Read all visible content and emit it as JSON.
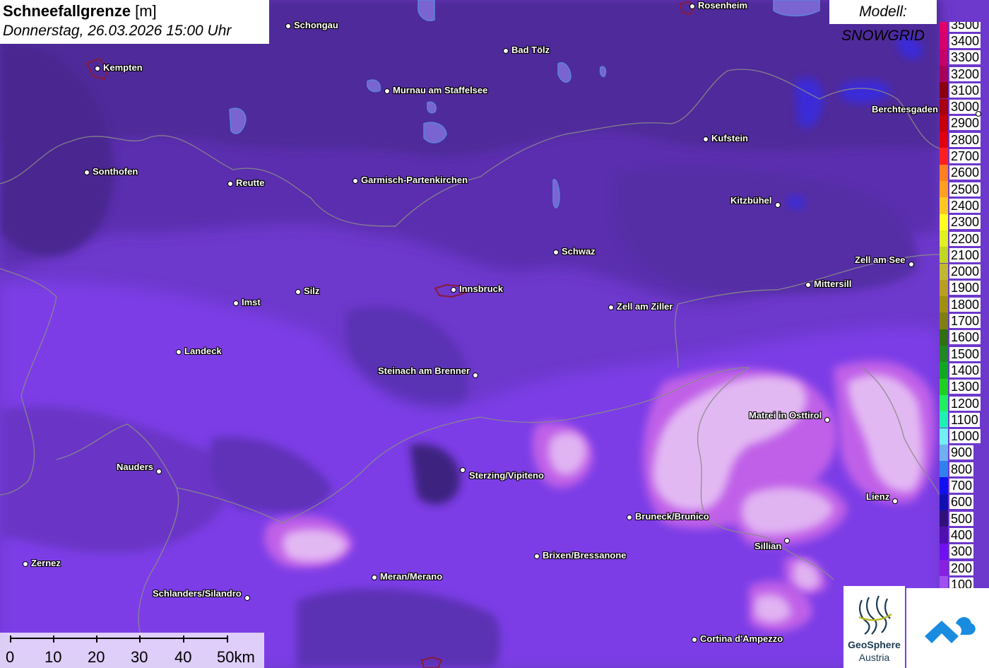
{
  "title": {
    "variable": "Schneefallgrenze",
    "unit": "[m]",
    "datetime": "Donnerstag, 26.03.2026 15:00 Uhr"
  },
  "model": "Modell: SNOWGRID",
  "legend": [
    {
      "label": "3500",
      "color": "#e0006a"
    },
    {
      "label": "3400",
      "color": "#d4006e"
    },
    {
      "label": "3300",
      "color": "#c4006a"
    },
    {
      "label": "3200",
      "color": "#a8005a"
    },
    {
      "label": "3100",
      "color": "#8a0010"
    },
    {
      "label": "3000",
      "color": "#a80010"
    },
    {
      "label": "2900",
      "color": "#c40008"
    },
    {
      "label": "2800",
      "color": "#e00010"
    },
    {
      "label": "2700",
      "color": "#ff2020"
    },
    {
      "label": "2600",
      "color": "#ff8020"
    },
    {
      "label": "2500",
      "color": "#ffa020"
    },
    {
      "label": "2400",
      "color": "#ffc820"
    },
    {
      "label": "2300",
      "color": "#ffff20"
    },
    {
      "label": "2200",
      "color": "#e0f020"
    },
    {
      "label": "2100",
      "color": "#c0d820"
    },
    {
      "label": "2000",
      "color": "#c0b830"
    },
    {
      "label": "1900",
      "color": "#b8a020"
    },
    {
      "label": "1800",
      "color": "#a09010"
    },
    {
      "label": "1700",
      "color": "#808010"
    },
    {
      "label": "1600",
      "color": "#307010"
    },
    {
      "label": "1500",
      "color": "#208820"
    },
    {
      "label": "1400",
      "color": "#10a820"
    },
    {
      "label": "1300",
      "color": "#20d020"
    },
    {
      "label": "1200",
      "color": "#20f060"
    },
    {
      "label": "1100",
      "color": "#20f0b0"
    },
    {
      "label": "1000",
      "color": "#70f0f0"
    },
    {
      "label": "900",
      "color": "#70b0f0"
    },
    {
      "label": "800",
      "color": "#3080f0"
    },
    {
      "label": "700",
      "color": "#1010f0"
    },
    {
      "label": "600",
      "color": "#1010b0"
    },
    {
      "label": "500",
      "color": "#30107a"
    },
    {
      "label": "400",
      "color": "#5010b0"
    },
    {
      "label": "300",
      "color": "#7010f0"
    },
    {
      "label": "200",
      "color": "#8820e0"
    },
    {
      "label": "100",
      "color": "#a050f0"
    }
  ],
  "cities": [
    {
      "name": "Rosenheim"
    },
    {
      "name": "Schongau"
    },
    {
      "name": "Kempten"
    },
    {
      "name": "Bad Tölz"
    },
    {
      "name": "Murnau am Staffelsee"
    },
    {
      "name": "Berchtesgaden"
    },
    {
      "name": "Kufstein"
    },
    {
      "name": "Sonthofen"
    },
    {
      "name": "Reutte"
    },
    {
      "name": "Garmisch-Partenkirchen"
    },
    {
      "name": "Kitzbühel"
    },
    {
      "name": "Schwaz"
    },
    {
      "name": "Zell am See"
    },
    {
      "name": "Mittersill"
    },
    {
      "name": "Imst"
    },
    {
      "name": "Silz"
    },
    {
      "name": "Innsbruck"
    },
    {
      "name": "Zell am Ziller"
    },
    {
      "name": "Landeck"
    },
    {
      "name": "Steinach am Brenner"
    },
    {
      "name": "Matrei in Osttirol"
    },
    {
      "name": "Nauders"
    },
    {
      "name": "Sterzing/Vipiteno"
    },
    {
      "name": "Lienz"
    },
    {
      "name": "Bruneck/Brunico"
    },
    {
      "name": "Sillian"
    },
    {
      "name": "Brixen/Bressanone"
    },
    {
      "name": "Zernez"
    },
    {
      "name": "Meran/Merano"
    },
    {
      "name": "Schlanders/Silandro"
    },
    {
      "name": "Cortina d'Ampezzo"
    }
  ],
  "scale_bar": {
    "ticks": [
      "0",
      "10",
      "20",
      "30",
      "40",
      "50km"
    ]
  },
  "logos": {
    "geosphere_line1": "GeoSphere",
    "geosphere_line2": "Austria"
  }
}
